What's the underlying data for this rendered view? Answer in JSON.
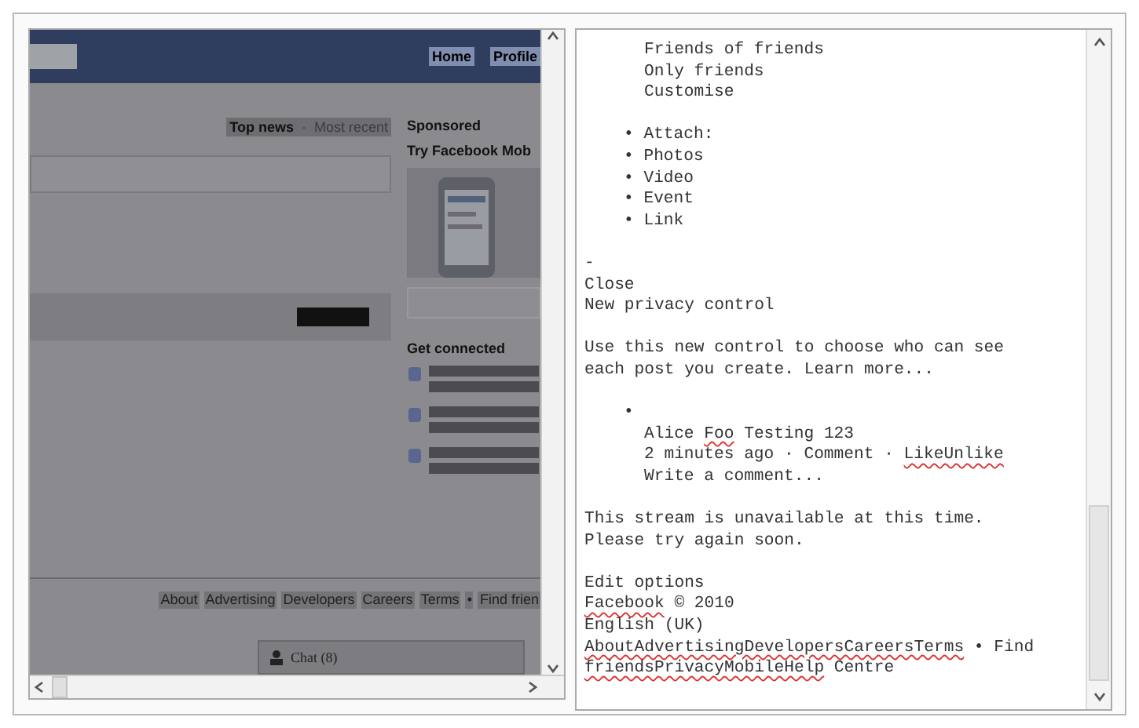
{
  "left_pane": {
    "top_bar": {
      "links": [
        "Home",
        "Profile"
      ]
    },
    "feed_tabs": {
      "selected": "Top news",
      "separator": "·",
      "other": "Most recent"
    },
    "sidebar": {
      "sponsored": "Sponsored",
      "ad_title": "Try Facebook Mob",
      "get_connected": "Get connected"
    },
    "footer_links": [
      "About",
      "Advertising",
      "Developers",
      "Careers",
      "Terms",
      "•",
      "Find frien"
    ],
    "chat": "Chat (8)"
  },
  "text_view": {
    "lines": [
      {
        "kind": "option",
        "segments": [
          {
            "text": "Friends of friends",
            "misspelled": false
          }
        ]
      },
      {
        "kind": "option",
        "segments": [
          {
            "text": "Only friends",
            "misspelled": false
          }
        ]
      },
      {
        "kind": "option",
        "segments": [
          {
            "text": "Customise",
            "misspelled": false
          }
        ]
      },
      {
        "kind": "blank"
      },
      {
        "kind": "bullet",
        "bullet": "•",
        "segments": [
          {
            "text": "Attach:",
            "misspelled": false
          }
        ]
      },
      {
        "kind": "bullet",
        "bullet": "•",
        "segments": [
          {
            "text": "Photos",
            "misspelled": false
          }
        ]
      },
      {
        "kind": "bullet",
        "bullet": "•",
        "segments": [
          {
            "text": "Video",
            "misspelled": false
          }
        ]
      },
      {
        "kind": "bullet",
        "bullet": "•",
        "segments": [
          {
            "text": "Event",
            "misspelled": false
          }
        ]
      },
      {
        "kind": "bullet",
        "bullet": "•",
        "segments": [
          {
            "text": "Link",
            "misspelled": false
          }
        ]
      },
      {
        "kind": "blank"
      },
      {
        "kind": "plain",
        "segments": [
          {
            "text": "-",
            "misspelled": false
          }
        ]
      },
      {
        "kind": "plain",
        "segments": [
          {
            "text": "Close",
            "misspelled": false
          }
        ]
      },
      {
        "kind": "plain",
        "segments": [
          {
            "text": "New privacy control",
            "misspelled": false
          }
        ]
      },
      {
        "kind": "blank"
      },
      {
        "kind": "plain",
        "segments": [
          {
            "text": "Use this new control to choose who can see",
            "misspelled": false
          }
        ]
      },
      {
        "kind": "plain",
        "segments": [
          {
            "text": "each post you create. Learn more...",
            "misspelled": false
          }
        ]
      },
      {
        "kind": "blank"
      },
      {
        "kind": "bullet-empty",
        "bullet": "•"
      },
      {
        "kind": "post",
        "segments": [
          {
            "text": "Alice ",
            "misspelled": false
          },
          {
            "text": "Foo",
            "misspelled": true
          },
          {
            "text": " Testing 123",
            "misspelled": false
          }
        ]
      },
      {
        "kind": "post",
        "segments": [
          {
            "text": "2 minutes ago · Comment · ",
            "misspelled": false
          },
          {
            "text": "LikeUnlike",
            "misspelled": true
          }
        ]
      },
      {
        "kind": "post",
        "segments": [
          {
            "text": "Write a comment...",
            "misspelled": false
          }
        ]
      },
      {
        "kind": "blank"
      },
      {
        "kind": "plain",
        "segments": [
          {
            "text": "This stream is unavailable at this time.",
            "misspelled": false
          }
        ]
      },
      {
        "kind": "plain",
        "segments": [
          {
            "text": "Please try again soon.",
            "misspelled": false
          }
        ]
      },
      {
        "kind": "blank"
      },
      {
        "kind": "plain",
        "segments": [
          {
            "text": "Edit options",
            "misspelled": false
          }
        ]
      },
      {
        "kind": "plain",
        "segments": [
          {
            "text": "Facebook",
            "misspelled": true
          },
          {
            "text": " © 2010",
            "misspelled": false
          }
        ]
      },
      {
        "kind": "plain",
        "segments": [
          {
            "text": "English (UK)",
            "misspelled": false
          }
        ]
      },
      {
        "kind": "plain",
        "segments": [
          {
            "text": "AboutAdvertisingDevelopersCareersTerms",
            "misspelled": true
          },
          {
            "text": " • Find",
            "misspelled": false
          }
        ]
      },
      {
        "kind": "plain",
        "segments": [
          {
            "text": "friendsPrivacyMobileHelp",
            "misspelled": true
          },
          {
            "text": " Centre",
            "misspelled": false
          }
        ]
      }
    ]
  }
}
